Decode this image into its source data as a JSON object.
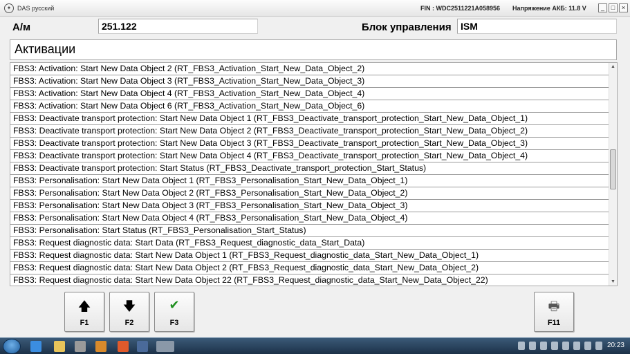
{
  "window": {
    "title": "DAS русский",
    "fin": "FIN : WDC2511221A058956",
    "battery": "Напряжение АКБ: 11.8 V",
    "controls": [
      "_",
      "□",
      "×"
    ]
  },
  "header": {
    "am_label": "А/м",
    "am_value": "251.122",
    "unit_label": "Блок управления",
    "unit_value": "ISM"
  },
  "section_title": "Активации",
  "list": {
    "items": [
      "FBS3: Activation: Start New Data Object 2 (RT_FBS3_Activation_Start_New_Data_Object_2)",
      "FBS3: Activation: Start New Data Object 3 (RT_FBS3_Activation_Start_New_Data_Object_3)",
      "FBS3: Activation: Start New Data Object 4 (RT_FBS3_Activation_Start_New_Data_Object_4)",
      "FBS3: Activation: Start New Data Object 6 (RT_FBS3_Activation_Start_New_Data_Object_6)",
      "FBS3: Deactivate transport protection: Start New Data Object 1 (RT_FBS3_Deactivate_transport_protection_Start_New_Data_Object_1)",
      "FBS3: Deactivate transport protection: Start New Data Object 2 (RT_FBS3_Deactivate_transport_protection_Start_New_Data_Object_2)",
      "FBS3: Deactivate transport protection: Start New Data Object 3 (RT_FBS3_Deactivate_transport_protection_Start_New_Data_Object_3)",
      "FBS3: Deactivate transport protection: Start New Data Object 4 (RT_FBS3_Deactivate_transport_protection_Start_New_Data_Object_4)",
      "FBS3: Deactivate transport protection: Start Status (RT_FBS3_Deactivate_transport_protection_Start_Status)",
      "FBS3: Personalisation: Start New Data Object 1 (RT_FBS3_Personalisation_Start_New_Data_Object_1)",
      "FBS3: Personalisation: Start New Data Object 2 (RT_FBS3_Personalisation_Start_New_Data_Object_2)",
      "FBS3: Personalisation: Start New Data Object 3 (RT_FBS3_Personalisation_Start_New_Data_Object_3)",
      "FBS3: Personalisation: Start New Data Object 4 (RT_FBS3_Personalisation_Start_New_Data_Object_4)",
      "FBS3: Personalisation: Start Status (RT_FBS3_Personalisation_Start_Status)",
      "FBS3: Request diagnostic data: Start Data (RT_FBS3_Request_diagnostic_data_Start_Data)",
      "FBS3: Request diagnostic data: Start New Data Object 1 (RT_FBS3_Request_diagnostic_data_Start_New_Data_Object_1)",
      "FBS3: Request diagnostic data: Start New Data Object 2 (RT_FBS3_Request_diagnostic_data_Start_New_Data_Object_2)",
      "FBS3: Request diagnostic data: Start New Data Object 22 (RT_FBS3_Request_diagnostic_data_Start_New_Data_Object_22)"
    ]
  },
  "fkeys": [
    {
      "label": "F1",
      "icon": "arrow-up-icon",
      "glyph": "🡅"
    },
    {
      "label": "F2",
      "icon": "arrow-down-icon",
      "glyph": "🡇"
    },
    {
      "label": "F3",
      "icon": "checkmark-icon",
      "glyph": "✔"
    },
    {
      "label": "F11",
      "icon": "printer-icon",
      "glyph": "🖶"
    }
  ],
  "taskbar": {
    "clock": "20:23"
  },
  "colors": {
    "check_green": "#1f8f1f",
    "taskbar": "#1c3148"
  }
}
